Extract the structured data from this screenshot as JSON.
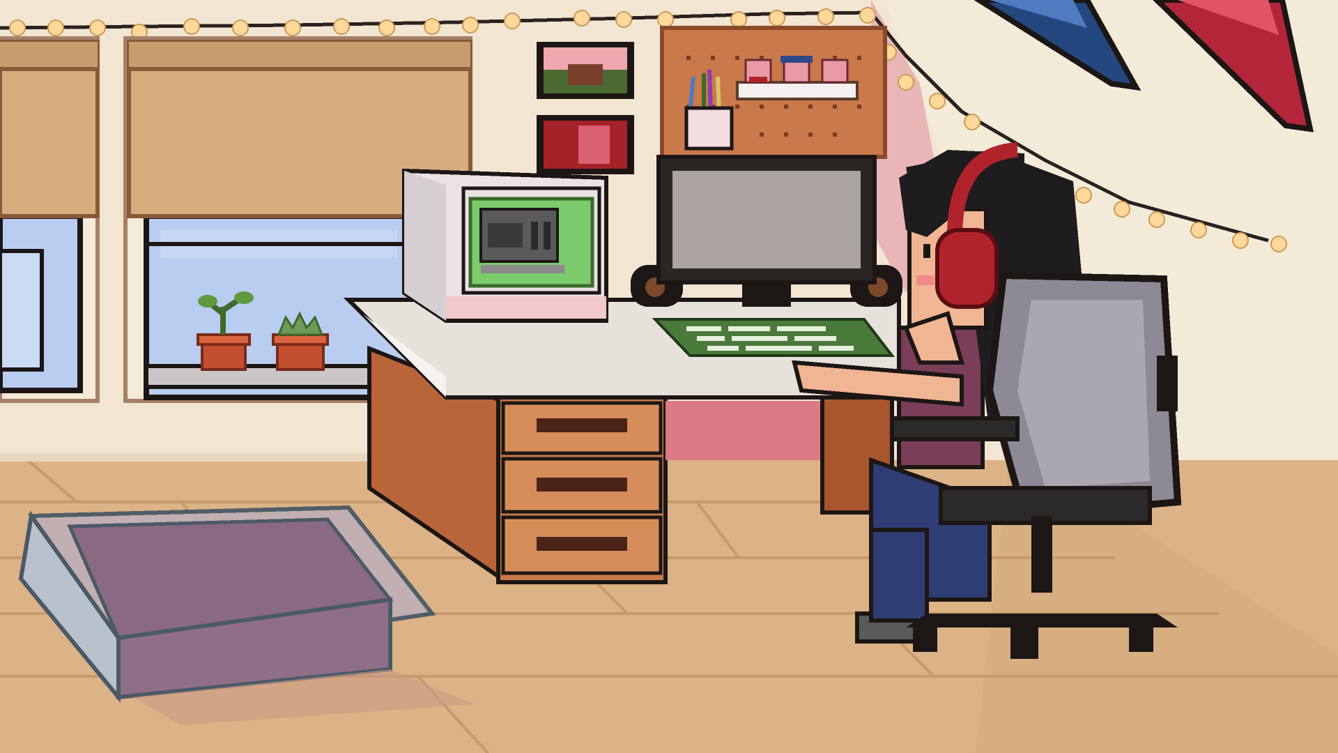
{
  "scene": {
    "type": "pixel-art room",
    "palette": {
      "wall": "#f2e6d2",
      "floor": "#dcb386",
      "floor_line": "#c79a6c",
      "desk_wood": "#c9794a",
      "desk_top": "#e7e1dc",
      "outline": "#1c1715",
      "window_sky": "#b9cdf0",
      "blind": "#d7ad7e",
      "crt_screen": "#7ccb6d",
      "monitor_screen": "#aaa3a0",
      "chair": "#8c8a94",
      "headphones": "#b0232b",
      "jeans": "#2e3d73",
      "rug": "#8a6a82",
      "pennant_blue": "#23487f",
      "pennant_red": "#b3263a",
      "fairy_light": "#ffd89a",
      "pink_wall_panel": "#e8b6b6"
    },
    "icons": {
      "window": "window-icon",
      "plant": "potted-plant-icon",
      "crt": "crt-monitor-icon",
      "monitor": "flat-monitor-icon",
      "keyboard": "keyboard-icon",
      "chair": "office-chair-icon",
      "character": "gamer-girl-icon",
      "pig_figurines": "pig-figurine-icon",
      "pencil_cup": "pencil-cup-icon",
      "photo": "photo-frame-icon",
      "pennant": "pennant-flag-icon",
      "lights": "fairy-light-icon",
      "rug": "floor-cushion-icon"
    }
  }
}
